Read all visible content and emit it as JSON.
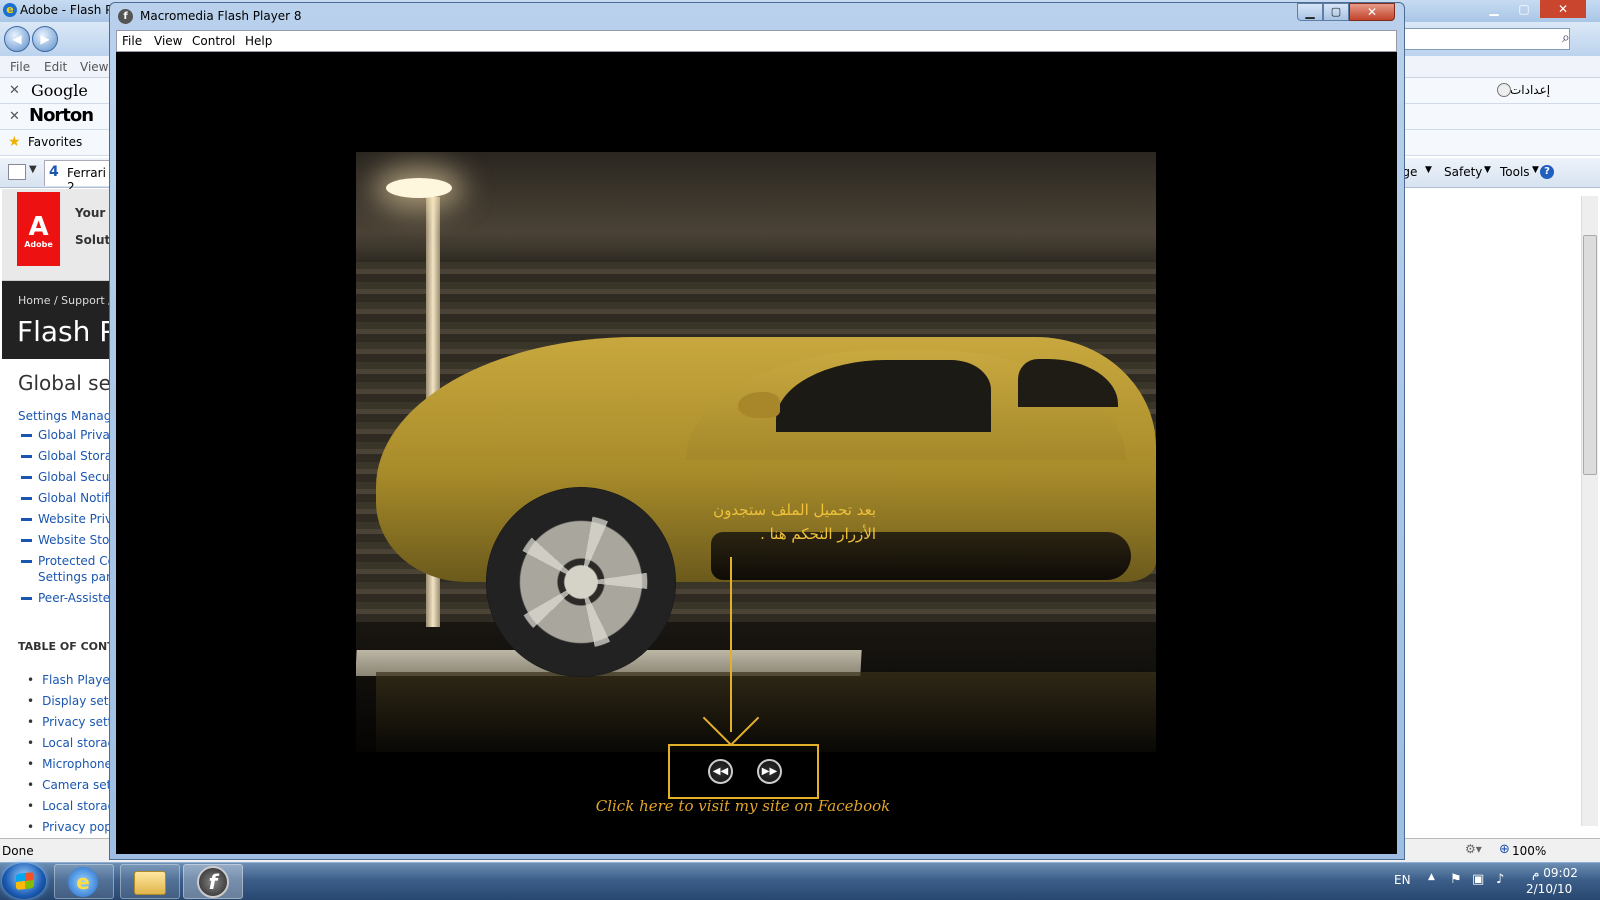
{
  "ie": {
    "title": "Adobe - Flash P",
    "menu": [
      "File",
      "Edit",
      "View"
    ],
    "google_label": "Google",
    "norton_label": "Norton",
    "settings_ar": "إعدادات",
    "favorites_label": "Favorites",
    "tab_label": "Ferrari 2",
    "commands": [
      "age",
      "Safety",
      "Tools"
    ],
    "status_text": "Done",
    "zoom": "100%"
  },
  "adobe_page": {
    "your": "Your a",
    "solut": "Soluti",
    "breadcrumb": "Home  /  Support  /",
    "heading": "Flash P",
    "subheading": "Global sec",
    "settings_link": "Settings Manage",
    "global_links": [
      "Global Privac",
      "Global Stora",
      "Global Secu",
      "Global Notifi",
      "Website Priva",
      "Website Stor",
      "Protected Co",
      "Peer-Assiste"
    ],
    "settings_panel_line": "Settings pan",
    "toc_title": "TABLE OF CONTE",
    "toc_links": [
      "Flash Player",
      "Display setti",
      "Privacy settin",
      "Local storag",
      "Microphone",
      "Camera sett",
      "Local storag",
      "Privacy pop-"
    ]
  },
  "flash_player": {
    "title": "Macromedia Flash Player 8",
    "menu": [
      "File",
      "View",
      "Control",
      "Help"
    ],
    "overlay_line1": "بعد تحميل الملف ستجدون",
    "overlay_line2": "الأزرار التحكم هنا .",
    "facebook_link": "Click here to visit my site on Facebook"
  },
  "taskbar": {
    "lang": "EN",
    "time": "09:02 م",
    "date": "2/10/10"
  },
  "colors": {
    "accent": "#e3b02a",
    "title_bar": "#a9c6e6"
  }
}
